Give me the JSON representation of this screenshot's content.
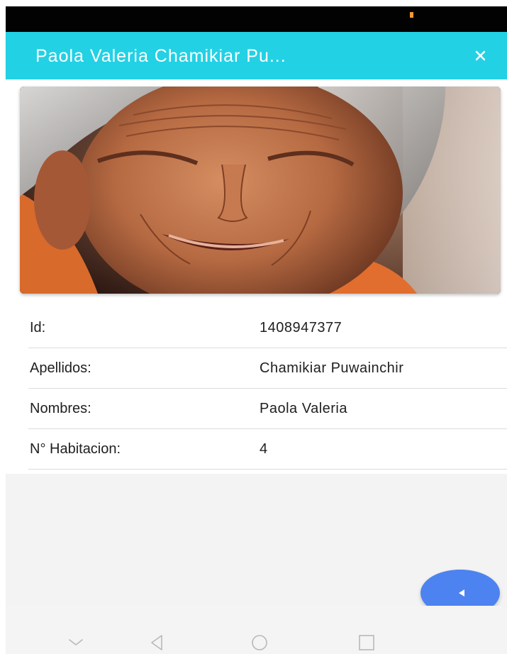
{
  "status_bar": {
    "indicator_color": "#f29a35"
  },
  "app_bar": {
    "title": "Paola Valeria Chamikiar Pu...",
    "background_color": "#23d1e4",
    "close_icon": "close-icon"
  },
  "photo": {
    "description_icon": "resident-photo"
  },
  "details": [
    {
      "label": "Id:",
      "value": "1408947377"
    },
    {
      "label": "Apellidos:",
      "value": "Chamikiar Puwainchir"
    },
    {
      "label": "Nombres:",
      "value": "Paola Valeria"
    },
    {
      "label": "N° Habitacion:",
      "value": "4"
    }
  ],
  "fab": {
    "icon": "play-back-icon",
    "color": "#4d83f0"
  },
  "nav_bar": {
    "buttons": [
      "chevron-down-icon",
      "back-icon",
      "home-icon",
      "recents-icon"
    ]
  }
}
